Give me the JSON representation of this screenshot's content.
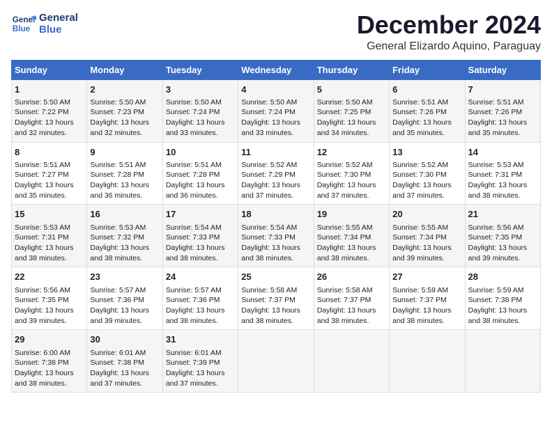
{
  "logo": {
    "line1": "General",
    "line2": "Blue"
  },
  "title": "December 2024",
  "location": "General Elizardo Aquino, Paraguay",
  "days_of_week": [
    "Sunday",
    "Monday",
    "Tuesday",
    "Wednesday",
    "Thursday",
    "Friday",
    "Saturday"
  ],
  "weeks": [
    [
      {
        "day": 1,
        "sunrise": "5:50 AM",
        "sunset": "7:22 PM",
        "daylight": "13 hours and 32 minutes."
      },
      {
        "day": 2,
        "sunrise": "5:50 AM",
        "sunset": "7:23 PM",
        "daylight": "13 hours and 32 minutes."
      },
      {
        "day": 3,
        "sunrise": "5:50 AM",
        "sunset": "7:24 PM",
        "daylight": "13 hours and 33 minutes."
      },
      {
        "day": 4,
        "sunrise": "5:50 AM",
        "sunset": "7:24 PM",
        "daylight": "13 hours and 33 minutes."
      },
      {
        "day": 5,
        "sunrise": "5:50 AM",
        "sunset": "7:25 PM",
        "daylight": "13 hours and 34 minutes."
      },
      {
        "day": 6,
        "sunrise": "5:51 AM",
        "sunset": "7:26 PM",
        "daylight": "13 hours and 35 minutes."
      },
      {
        "day": 7,
        "sunrise": "5:51 AM",
        "sunset": "7:26 PM",
        "daylight": "13 hours and 35 minutes."
      }
    ],
    [
      {
        "day": 8,
        "sunrise": "5:51 AM",
        "sunset": "7:27 PM",
        "daylight": "13 hours and 35 minutes."
      },
      {
        "day": 9,
        "sunrise": "5:51 AM",
        "sunset": "7:28 PM",
        "daylight": "13 hours and 36 minutes."
      },
      {
        "day": 10,
        "sunrise": "5:51 AM",
        "sunset": "7:28 PM",
        "daylight": "13 hours and 36 minutes."
      },
      {
        "day": 11,
        "sunrise": "5:52 AM",
        "sunset": "7:29 PM",
        "daylight": "13 hours and 37 minutes."
      },
      {
        "day": 12,
        "sunrise": "5:52 AM",
        "sunset": "7:30 PM",
        "daylight": "13 hours and 37 minutes."
      },
      {
        "day": 13,
        "sunrise": "5:52 AM",
        "sunset": "7:30 PM",
        "daylight": "13 hours and 37 minutes."
      },
      {
        "day": 14,
        "sunrise": "5:53 AM",
        "sunset": "7:31 PM",
        "daylight": "13 hours and 38 minutes."
      }
    ],
    [
      {
        "day": 15,
        "sunrise": "5:53 AM",
        "sunset": "7:31 PM",
        "daylight": "13 hours and 38 minutes."
      },
      {
        "day": 16,
        "sunrise": "5:53 AM",
        "sunset": "7:32 PM",
        "daylight": "13 hours and 38 minutes."
      },
      {
        "day": 17,
        "sunrise": "5:54 AM",
        "sunset": "7:33 PM",
        "daylight": "13 hours and 38 minutes."
      },
      {
        "day": 18,
        "sunrise": "5:54 AM",
        "sunset": "7:33 PM",
        "daylight": "13 hours and 38 minutes."
      },
      {
        "day": 19,
        "sunrise": "5:55 AM",
        "sunset": "7:34 PM",
        "daylight": "13 hours and 38 minutes."
      },
      {
        "day": 20,
        "sunrise": "5:55 AM",
        "sunset": "7:34 PM",
        "daylight": "13 hours and 39 minutes."
      },
      {
        "day": 21,
        "sunrise": "5:56 AM",
        "sunset": "7:35 PM",
        "daylight": "13 hours and 39 minutes."
      }
    ],
    [
      {
        "day": 22,
        "sunrise": "5:56 AM",
        "sunset": "7:35 PM",
        "daylight": "13 hours and 39 minutes."
      },
      {
        "day": 23,
        "sunrise": "5:57 AM",
        "sunset": "7:36 PM",
        "daylight": "13 hours and 39 minutes."
      },
      {
        "day": 24,
        "sunrise": "5:57 AM",
        "sunset": "7:36 PM",
        "daylight": "13 hours and 38 minutes."
      },
      {
        "day": 25,
        "sunrise": "5:58 AM",
        "sunset": "7:37 PM",
        "daylight": "13 hours and 38 minutes."
      },
      {
        "day": 26,
        "sunrise": "5:58 AM",
        "sunset": "7:37 PM",
        "daylight": "13 hours and 38 minutes."
      },
      {
        "day": 27,
        "sunrise": "5:59 AM",
        "sunset": "7:37 PM",
        "daylight": "13 hours and 38 minutes."
      },
      {
        "day": 28,
        "sunrise": "5:59 AM",
        "sunset": "7:38 PM",
        "daylight": "13 hours and 38 minutes."
      }
    ],
    [
      {
        "day": 29,
        "sunrise": "6:00 AM",
        "sunset": "7:38 PM",
        "daylight": "13 hours and 38 minutes."
      },
      {
        "day": 30,
        "sunrise": "6:01 AM",
        "sunset": "7:38 PM",
        "daylight": "13 hours and 37 minutes."
      },
      {
        "day": 31,
        "sunrise": "6:01 AM",
        "sunset": "7:39 PM",
        "daylight": "13 hours and 37 minutes."
      },
      null,
      null,
      null,
      null
    ]
  ]
}
